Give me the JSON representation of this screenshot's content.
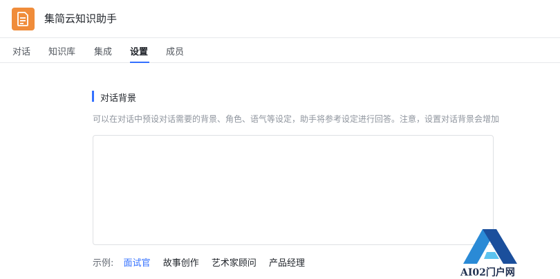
{
  "app": {
    "title": "集简云知识助手",
    "icon": "document-icon",
    "icon_color": "#f08c3a"
  },
  "tabs": [
    {
      "label": "对话"
    },
    {
      "label": "知识库"
    },
    {
      "label": "集成"
    },
    {
      "label": "设置",
      "active": true
    },
    {
      "label": "成员"
    }
  ],
  "accent_color": "#3370ff",
  "section": {
    "title": "对话背景",
    "description": "可以在对话中预设对话需要的背景、角色、语气等设定，助手将参考设定进行回答。注意，设置对话背景会增加",
    "textarea_value": ""
  },
  "examples": {
    "label": "示例:",
    "items": [
      {
        "label": "面试官",
        "active": true
      },
      {
        "label": "故事创作"
      },
      {
        "label": "艺术家顾问"
      },
      {
        "label": "产品经理"
      }
    ]
  },
  "watermark": {
    "text": "AI02门户网"
  }
}
